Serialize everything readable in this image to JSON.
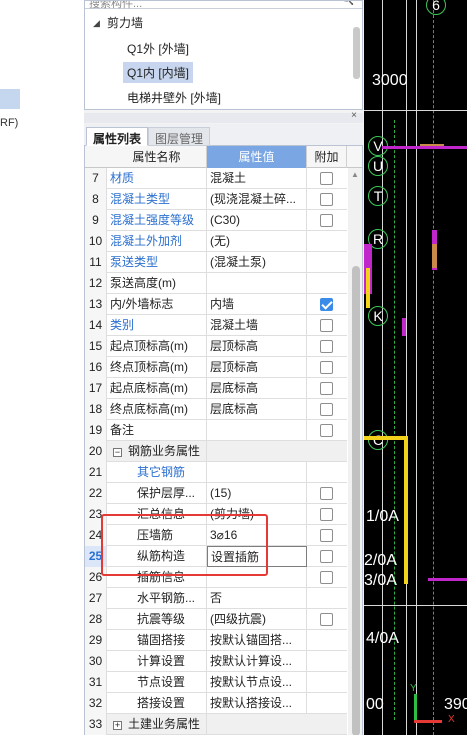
{
  "left_strip": {
    "label": "RF)"
  },
  "tree": {
    "search_placeholder": "搜索构件...",
    "root": "剪力墙",
    "items": [
      {
        "label": "Q1外 [外墙]",
        "selected": false
      },
      {
        "label": "Q1内 [内墙]",
        "selected": true
      },
      {
        "label": "电梯井壁外 [外墙]",
        "selected": false
      }
    ]
  },
  "tabs": [
    "属性列表",
    "图层管理"
  ],
  "table": {
    "headers": {
      "name": "属性名称",
      "value": "属性值",
      "add": "附加"
    },
    "rows": [
      {
        "num": "7",
        "name": "材质",
        "value": "混凝土",
        "blue": true,
        "cb": false
      },
      {
        "num": "8",
        "name": "混凝土类型",
        "value": "(现浇混凝土碎...",
        "blue": true,
        "cb": false
      },
      {
        "num": "9",
        "name": "混凝土强度等级",
        "value": "(C30)",
        "blue": true,
        "cb": false
      },
      {
        "num": "10",
        "name": "混凝土外加剂",
        "value": "(无)",
        "blue": true,
        "cb": null
      },
      {
        "num": "11",
        "name": "泵送类型",
        "value": "(混凝土泵)",
        "blue": true,
        "cb": null
      },
      {
        "num": "12",
        "name": "泵送高度(m)",
        "value": "",
        "blue": false,
        "cb": null
      },
      {
        "num": "13",
        "name": "内/外墙标志",
        "value": "内墙",
        "blue": false,
        "cb": true
      },
      {
        "num": "14",
        "name": "类别",
        "value": "混凝土墙",
        "blue": true,
        "cb": false
      },
      {
        "num": "15",
        "name": "起点顶标高(m)",
        "value": "层顶标高",
        "blue": false,
        "cb": false
      },
      {
        "num": "16",
        "name": "终点顶标高(m)",
        "value": "层顶标高",
        "blue": false,
        "cb": false
      },
      {
        "num": "17",
        "name": "起点底标高(m)",
        "value": "层底标高",
        "blue": false,
        "cb": false
      },
      {
        "num": "18",
        "name": "终点底标高(m)",
        "value": "层底标高",
        "blue": false,
        "cb": false
      },
      {
        "num": "19",
        "name": "备注",
        "value": "",
        "blue": false,
        "cb": false
      },
      {
        "num": "20",
        "name": "钢筋业务属性",
        "value": "",
        "group": true,
        "expander": "−"
      },
      {
        "num": "21",
        "name": "其它钢筋",
        "value": "",
        "blue": true,
        "indent": true,
        "cb": null
      },
      {
        "num": "22",
        "name": "保护层厚...",
        "value": "(15)",
        "indent": true,
        "cb": false
      },
      {
        "num": "23",
        "name": "汇总信息",
        "value": "(剪力墙)",
        "indent": true,
        "cb": false
      },
      {
        "num": "24",
        "name": "压墙筋",
        "value": "3⌀16",
        "indent": true,
        "cb": false
      },
      {
        "num": "25",
        "name": "纵筋构造",
        "value": "设置插筋",
        "indent": true,
        "cb": false,
        "current": true,
        "edit": true
      },
      {
        "num": "26",
        "name": "插筋信息",
        "value": "",
        "indent": true,
        "cb": false
      },
      {
        "num": "27",
        "name": "水平钢筋...",
        "value": "否",
        "indent": true,
        "cb": null
      },
      {
        "num": "28",
        "name": "抗震等级",
        "value": "(四级抗震)",
        "indent": true,
        "cb": false
      },
      {
        "num": "29",
        "name": "锚固搭接",
        "value": "按默认锚固搭...",
        "indent": true,
        "cb": null
      },
      {
        "num": "30",
        "name": "计算设置",
        "value": "按默认计算设...",
        "indent": true,
        "cb": null
      },
      {
        "num": "31",
        "name": "节点设置",
        "value": "按默认节点设...",
        "indent": true,
        "cb": null
      },
      {
        "num": "32",
        "name": "搭接设置",
        "value": "按默认搭接设...",
        "indent": true,
        "cb": null
      },
      {
        "num": "33",
        "name": "土建业务属性",
        "value": "",
        "group": true,
        "expander": "+"
      }
    ]
  },
  "cad": {
    "axis_labels": [
      "6",
      "V",
      "U",
      "T",
      "R",
      "K",
      "C"
    ],
    "dims": [
      "3000",
      "1/0A",
      "2/0A",
      "3/0A",
      "4/0A",
      "00",
      "390"
    ],
    "axis_x": "X",
    "axis_y": "Y"
  }
}
